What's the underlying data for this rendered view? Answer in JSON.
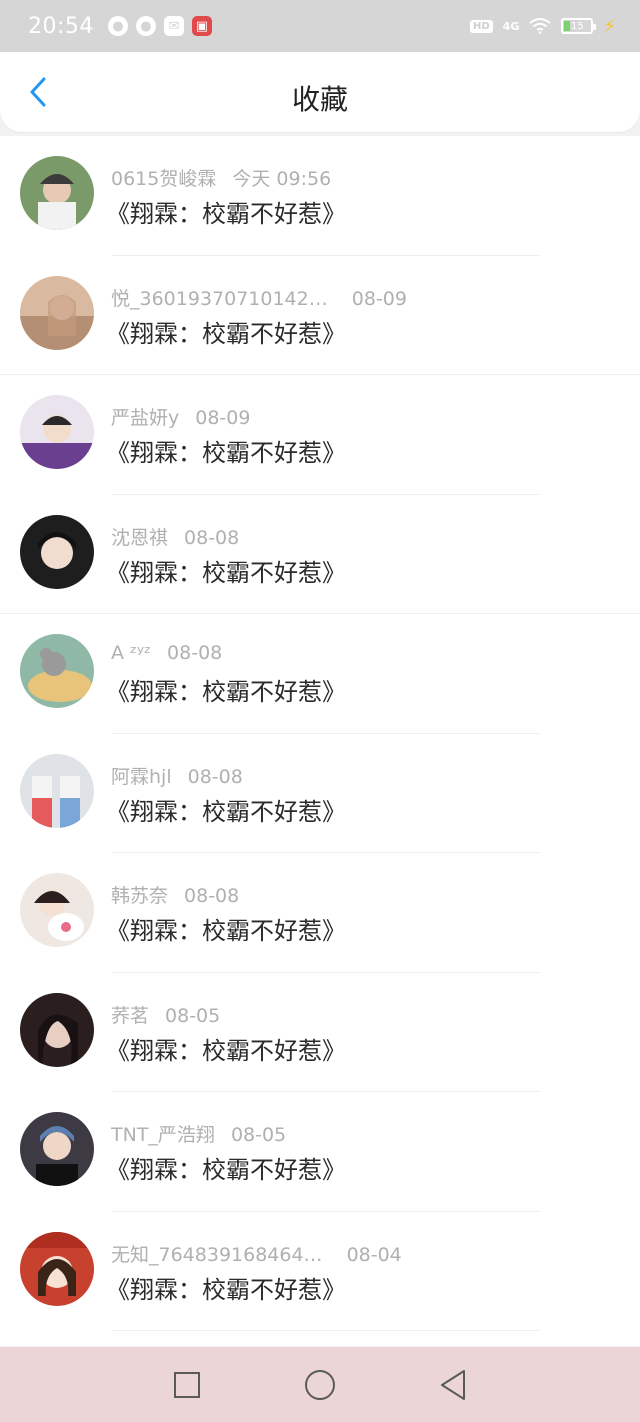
{
  "status_bar": {
    "time": "20:54",
    "network": "4G",
    "hd": "HD",
    "battery": "15"
  },
  "header": {
    "title": "收藏"
  },
  "colors": {
    "accent": "#2196f3",
    "nav_bg": "#ecd5d7",
    "status_bg": "#d6d6d6"
  },
  "items": [
    {
      "name": "0615贺峻霖",
      "time": "今天 09:56",
      "book": "《翔霖：校霸不好惹》"
    },
    {
      "name": "悦_36019370710142…",
      "time": "08-09",
      "book": "《翔霖：校霸不好惹》"
    },
    {
      "name": "严盐妍y",
      "time": "08-09",
      "book": "《翔霖：校霸不好惹》"
    },
    {
      "name": "沈恩祺",
      "time": "08-08",
      "book": "《翔霖：校霸不好惹》"
    },
    {
      "name": "A ᶻʸᶻ",
      "time": "08-08",
      "book": "《翔霖：校霸不好惹》"
    },
    {
      "name": "阿霖hjl",
      "time": "08-08",
      "book": "《翔霖：校霸不好惹》"
    },
    {
      "name": "韩苏奈",
      "time": "08-08",
      "book": "《翔霖：校霸不好惹》"
    },
    {
      "name": "荞茗",
      "time": "08-05",
      "book": "《翔霖：校霸不好惹》"
    },
    {
      "name": "TNT_严浩翔",
      "time": "08-05",
      "book": "《翔霖：校霸不好惹》"
    },
    {
      "name": "无知_764839168464…",
      "time": "08-04",
      "book": "《翔霖：校霸不好惹》"
    }
  ]
}
